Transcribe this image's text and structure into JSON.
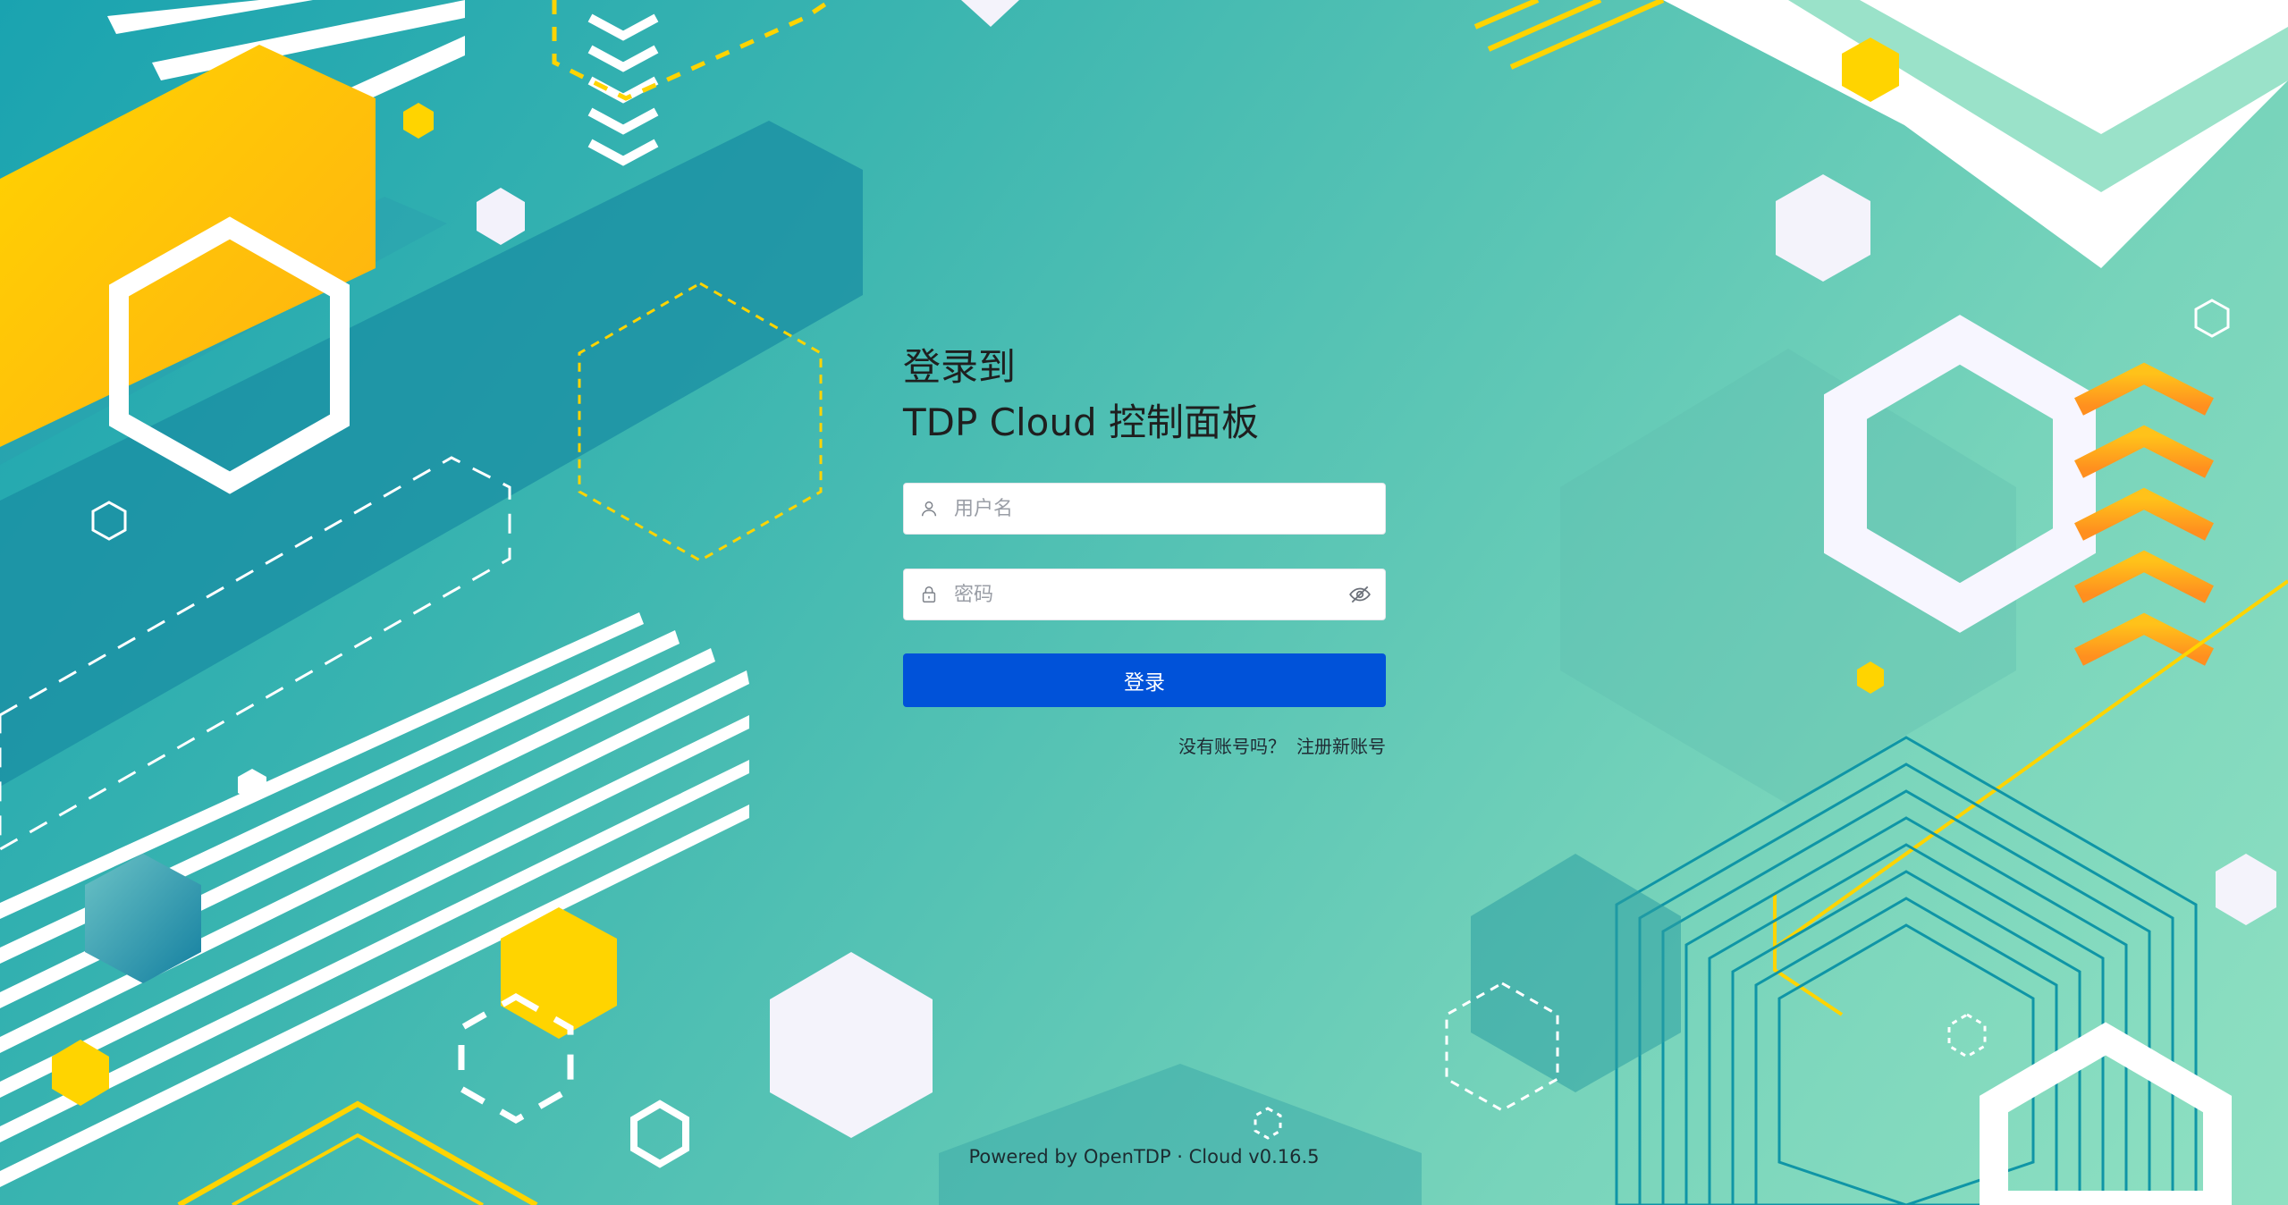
{
  "login": {
    "title_line1": "登录到",
    "title_line2": "TDP Cloud 控制面板",
    "username_placeholder": "用户名",
    "password_placeholder": "密码",
    "submit_label": "登录",
    "no_account_text": "没有账号吗？",
    "register_link": "注册新账号"
  },
  "footer": {
    "text": "Powered by OpenTDP · Cloud v0.16.5"
  },
  "icons": {
    "username": "user-icon",
    "password": "lock-icon",
    "toggle": "eye-off-icon"
  },
  "colors": {
    "primary": "#0052d9",
    "accent_yellow": "#ffd400",
    "accent_orange": "#ffa51f",
    "teal_dark": "#1387a0",
    "teal_light": "#8fe0c2"
  }
}
